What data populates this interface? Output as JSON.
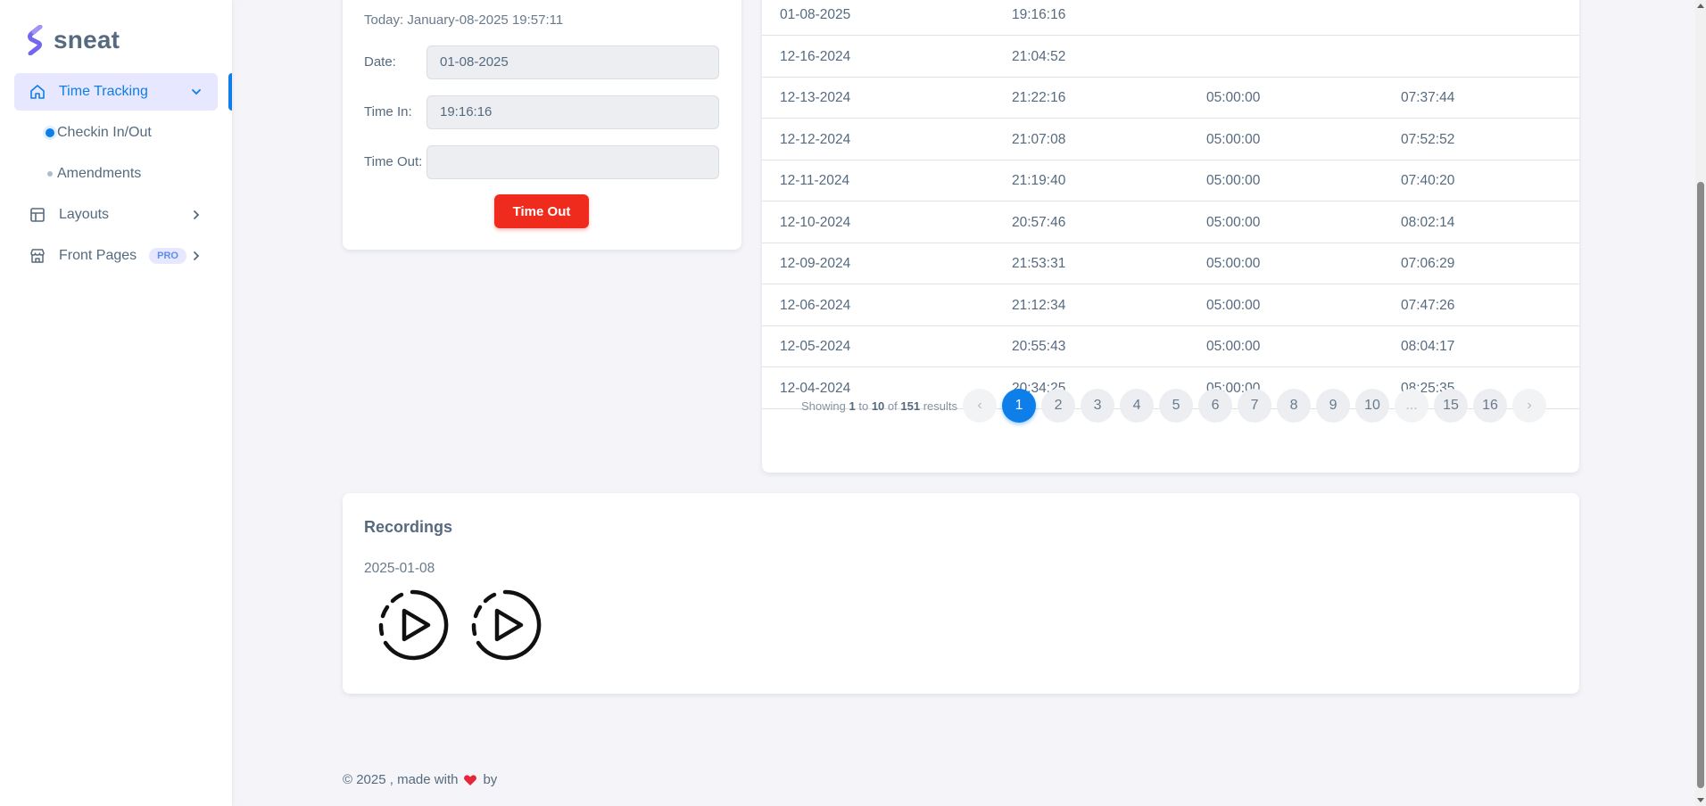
{
  "brand": {
    "name": "sneat"
  },
  "sidebar": {
    "items": [
      {
        "label": "Time Tracking"
      },
      {
        "label": "Checkin In/Out"
      },
      {
        "label": "Amendments"
      },
      {
        "label": "Layouts"
      },
      {
        "label": "Front Pages",
        "badge": "PRO"
      }
    ]
  },
  "checkin": {
    "today": "Today: January-08-2025 19:57:11",
    "date_label": "Date:",
    "date_value": "01-08-2025",
    "time_in_label": "Time In:",
    "time_in_value": "19:16:16",
    "time_out_label": "Time Out:",
    "time_out_value": "",
    "button": "Time Out"
  },
  "table": {
    "rows": [
      {
        "date": "01-08-2025",
        "time_in": "19:16:16",
        "time_out": "",
        "total": ""
      },
      {
        "date": "12-16-2024",
        "time_in": "21:04:52",
        "time_out": "",
        "total": ""
      },
      {
        "date": "12-13-2024",
        "time_in": "21:22:16",
        "time_out": "05:00:00",
        "total": "07:37:44"
      },
      {
        "date": "12-12-2024",
        "time_in": "21:07:08",
        "time_out": "05:00:00",
        "total": "07:52:52"
      },
      {
        "date": "12-11-2024",
        "time_in": "21:19:40",
        "time_out": "05:00:00",
        "total": "07:40:20"
      },
      {
        "date": "12-10-2024",
        "time_in": "20:57:46",
        "time_out": "05:00:00",
        "total": "08:02:14"
      },
      {
        "date": "12-09-2024",
        "time_in": "21:53:31",
        "time_out": "05:00:00",
        "total": "07:06:29"
      },
      {
        "date": "12-06-2024",
        "time_in": "21:12:34",
        "time_out": "05:00:00",
        "total": "07:47:26"
      },
      {
        "date": "12-05-2024",
        "time_in": "20:55:43",
        "time_out": "05:00:00",
        "total": "08:04:17"
      },
      {
        "date": "12-04-2024",
        "time_in": "20:34:25",
        "time_out": "05:00:00",
        "total": "08:25:35"
      }
    ],
    "pagination": {
      "showing_prefix": "Showing",
      "from": "1",
      "to_word": "to",
      "to": "10",
      "of_word": "of",
      "total": "151",
      "results_word": "results",
      "prev": "‹",
      "next": "›",
      "pages": [
        "1",
        "2",
        "3",
        "4",
        "5",
        "6",
        "7",
        "8",
        "9",
        "10",
        "...",
        "15",
        "16"
      ],
      "current": "1"
    }
  },
  "recordings": {
    "title": "Recordings",
    "date": "2025-01-08",
    "items": [
      "play-recording-1",
      "play-recording-2"
    ]
  },
  "footer": {
    "before": "© 2025 , made with",
    "after": "by"
  },
  "colors": {
    "accent": "#0d7eea",
    "danger": "#ee2b1c",
    "brand": "#696cff",
    "heart": "#e8263a"
  }
}
